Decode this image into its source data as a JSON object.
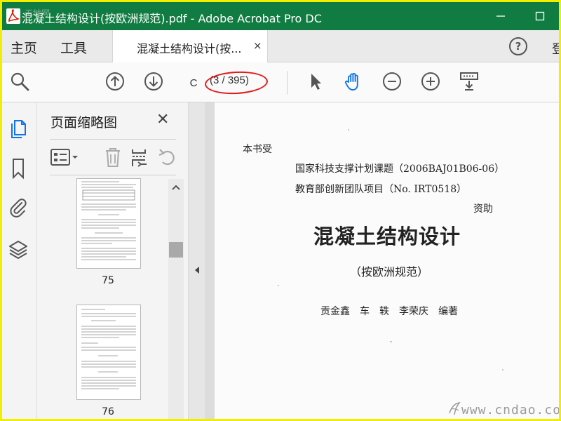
{
  "window": {
    "title": "混凝土结构设计(按欧洲规范).pdf - Adobe Acrobat Pro DC",
    "watermark_corner": "天地网"
  },
  "menu": {
    "home": "主页",
    "tools": "工具"
  },
  "tab": {
    "label": "混凝土结构设计(按...",
    "close": "×"
  },
  "login": "登",
  "toolbar": {
    "page_value": "C",
    "page_count": "(3 / 395)"
  },
  "panel": {
    "title": "页面缩略图",
    "close": "✕",
    "thumbnails": [
      {
        "label": "75"
      },
      {
        "label": "76"
      }
    ]
  },
  "page": {
    "line1": "本书受",
    "line2": "国家科技支撑计划课题（2006BAJ01B06-06）",
    "line3": "教育部创新团队项目（No. IRT0518）",
    "line4": "资助",
    "title": "混凝土结构设计",
    "subtitle": "（按欧洲规范）",
    "authors": "贡金鑫　车　轶　李荣庆　编著"
  },
  "watermark": "www.cndao.com",
  "colors": {
    "titlebar": "#107c41",
    "accent_blue": "#1473e6",
    "annotation_red": "#e01b1b"
  }
}
